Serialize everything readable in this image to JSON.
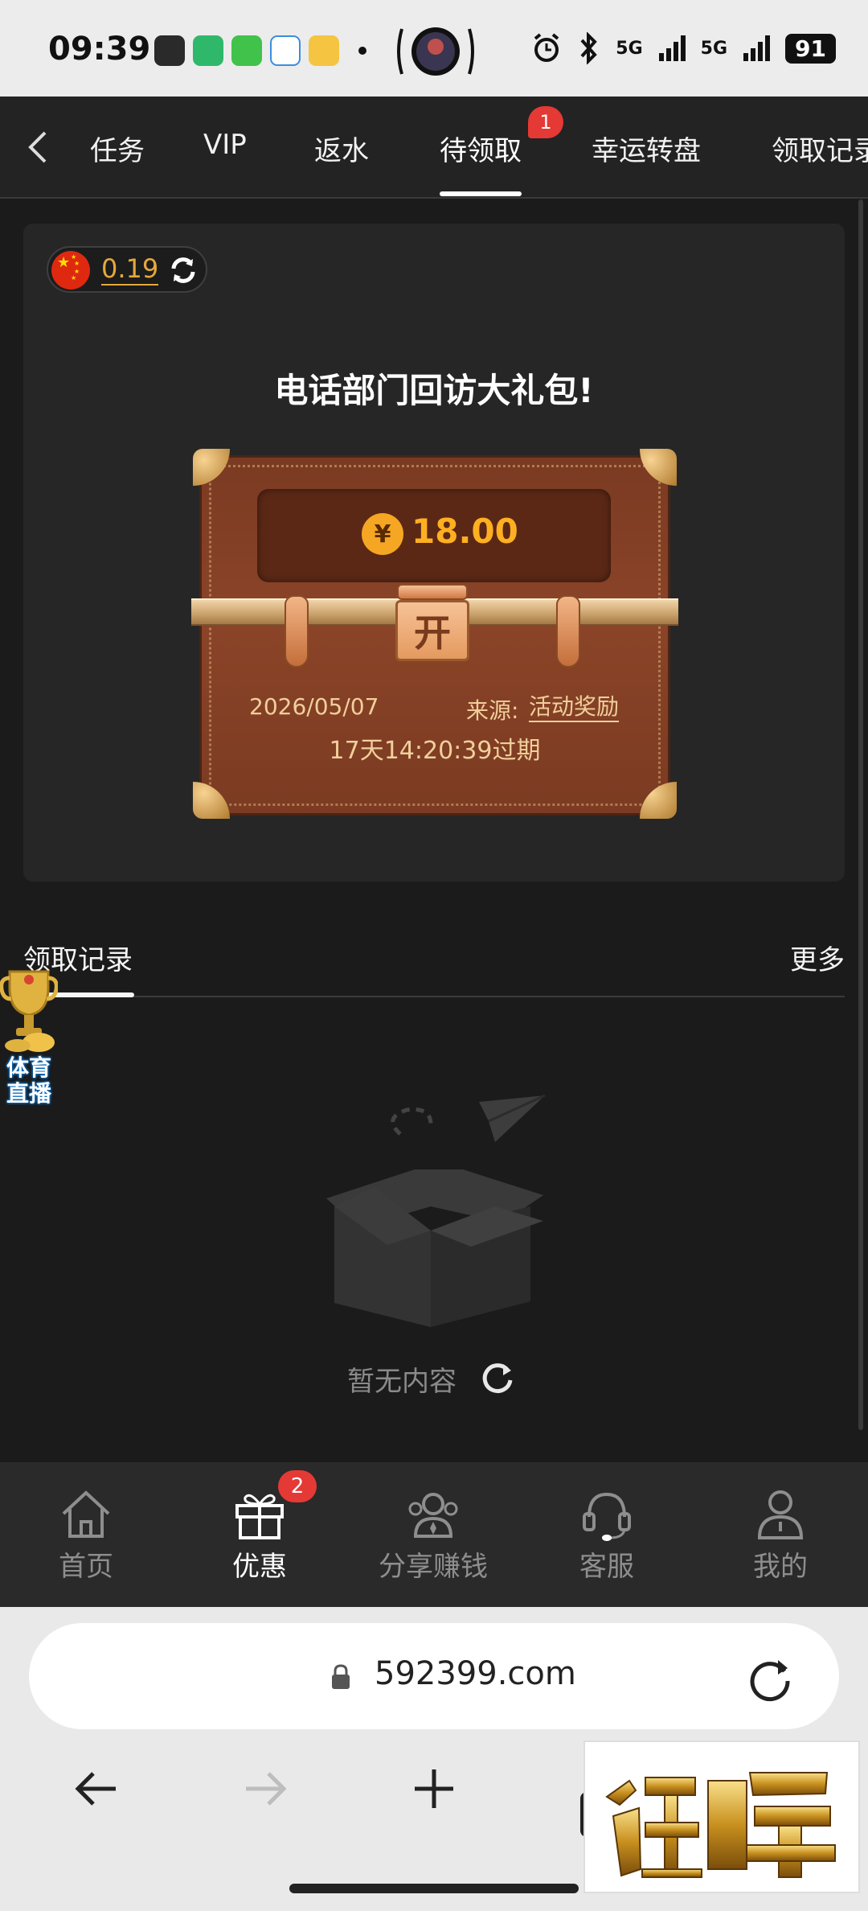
{
  "status_bar": {
    "time": "09:39",
    "network_1": "5G",
    "network_2": "5G",
    "battery": "91"
  },
  "top_tabs": {
    "items": [
      "任务",
      "VIP",
      "返水",
      "待领取",
      "幸运转盘",
      "领取记录"
    ],
    "active_index": 3,
    "badge": "1"
  },
  "balance": {
    "amount": "0.19"
  },
  "gift": {
    "title": "电话部门回访大礼包!",
    "amount": "18.00",
    "currency_symbol": "¥",
    "lock_label": "开",
    "date": "2026/05/07",
    "source_label": "来源:",
    "source": "活动奖励",
    "expire": "17天14:20:39过期"
  },
  "records": {
    "title": "领取记录",
    "more": "更多",
    "empty_text": "暂无内容"
  },
  "float_badge": {
    "label": "体育直播"
  },
  "bottom_nav": {
    "items": [
      "首页",
      "优惠",
      "分享赚钱",
      "客服",
      "我的"
    ],
    "active_index": 1,
    "badge": "2"
  },
  "browser": {
    "url": "592399.com"
  },
  "logo_overlay": {
    "text": "迷人牌"
  },
  "colors": {
    "accent_gold": "#e5a93a",
    "badge_red": "#e53935",
    "page_bg": "#1b1b1b",
    "card_bg": "#262626"
  }
}
